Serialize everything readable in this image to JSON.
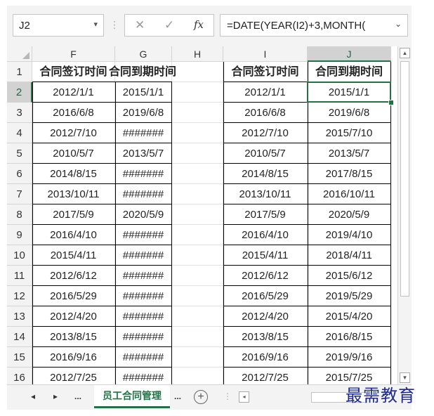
{
  "formula_bar": {
    "name_box": "J2",
    "name_dropdown": "▾",
    "dots": "⋮",
    "cancel": "✕",
    "enter": "✓",
    "fx": "fx",
    "formula": "=DATE(YEAR(I2)+3,MONTH(",
    "expand": "⌄"
  },
  "columns": [
    "F",
    "G",
    "H",
    "I",
    "J"
  ],
  "rows": [
    "1",
    "2",
    "3",
    "4",
    "5",
    "6",
    "7",
    "8",
    "9",
    "10",
    "11",
    "12",
    "13",
    "14",
    "15",
    "16"
  ],
  "header_row": {
    "F": "合同签订时间",
    "G": "合同到期时间",
    "I": "合同签订时间",
    "J": "合同到期时间"
  },
  "data": [
    {
      "F": "2012/1/1",
      "G": "2015/1/1",
      "I": "2012/1/1",
      "J": "2015/1/1"
    },
    {
      "F": "2016/6/8",
      "G": "2019/6/8",
      "I": "2016/6/8",
      "J": "2019/6/8"
    },
    {
      "F": "2012/7/10",
      "G": "#######",
      "I": "2012/7/10",
      "J": "2015/7/10"
    },
    {
      "F": "2010/5/7",
      "G": "2013/5/7",
      "I": "2010/5/7",
      "J": "2013/5/7"
    },
    {
      "F": "2014/8/15",
      "G": "#######",
      "I": "2014/8/15",
      "J": "2017/8/15"
    },
    {
      "F": "2013/10/11",
      "G": "#######",
      "I": "2013/10/11",
      "J": "2016/10/11"
    },
    {
      "F": "2017/5/9",
      "G": "2020/5/9",
      "I": "2017/5/9",
      "J": "2020/5/9"
    },
    {
      "F": "2016/4/10",
      "G": "#######",
      "I": "2016/4/10",
      "J": "2019/4/10"
    },
    {
      "F": "2015/4/11",
      "G": "#######",
      "I": "2015/4/11",
      "J": "2018/4/11"
    },
    {
      "F": "2012/6/12",
      "G": "#######",
      "I": "2012/6/12",
      "J": "2015/6/12"
    },
    {
      "F": "2016/5/29",
      "G": "#######",
      "I": "2016/5/29",
      "J": "2019/5/29"
    },
    {
      "F": "2012/4/20",
      "G": "#######",
      "I": "2012/4/20",
      "J": "2015/4/20"
    },
    {
      "F": "2013/8/15",
      "G": "#######",
      "I": "2013/8/15",
      "J": "2016/8/15"
    },
    {
      "F": "2016/9/16",
      "G": "#######",
      "I": "2016/9/16",
      "J": "2019/9/16"
    },
    {
      "F": "2012/7/25",
      "G": "#######",
      "I": "2012/7/25",
      "J": "2015/7/25"
    }
  ],
  "tabs": {
    "prev": "◂",
    "next": "▸",
    "more_left": "...",
    "active_sheet": "员工合同管理",
    "more_right": "...",
    "add": "+",
    "dots": "⋮",
    "scroll_left": "◂"
  },
  "scrollbar": {
    "up": "▲",
    "down": "▼"
  },
  "watermark": "最需教育",
  "colors": {
    "accent": "#217346",
    "watermark": "#1f2a8c"
  }
}
